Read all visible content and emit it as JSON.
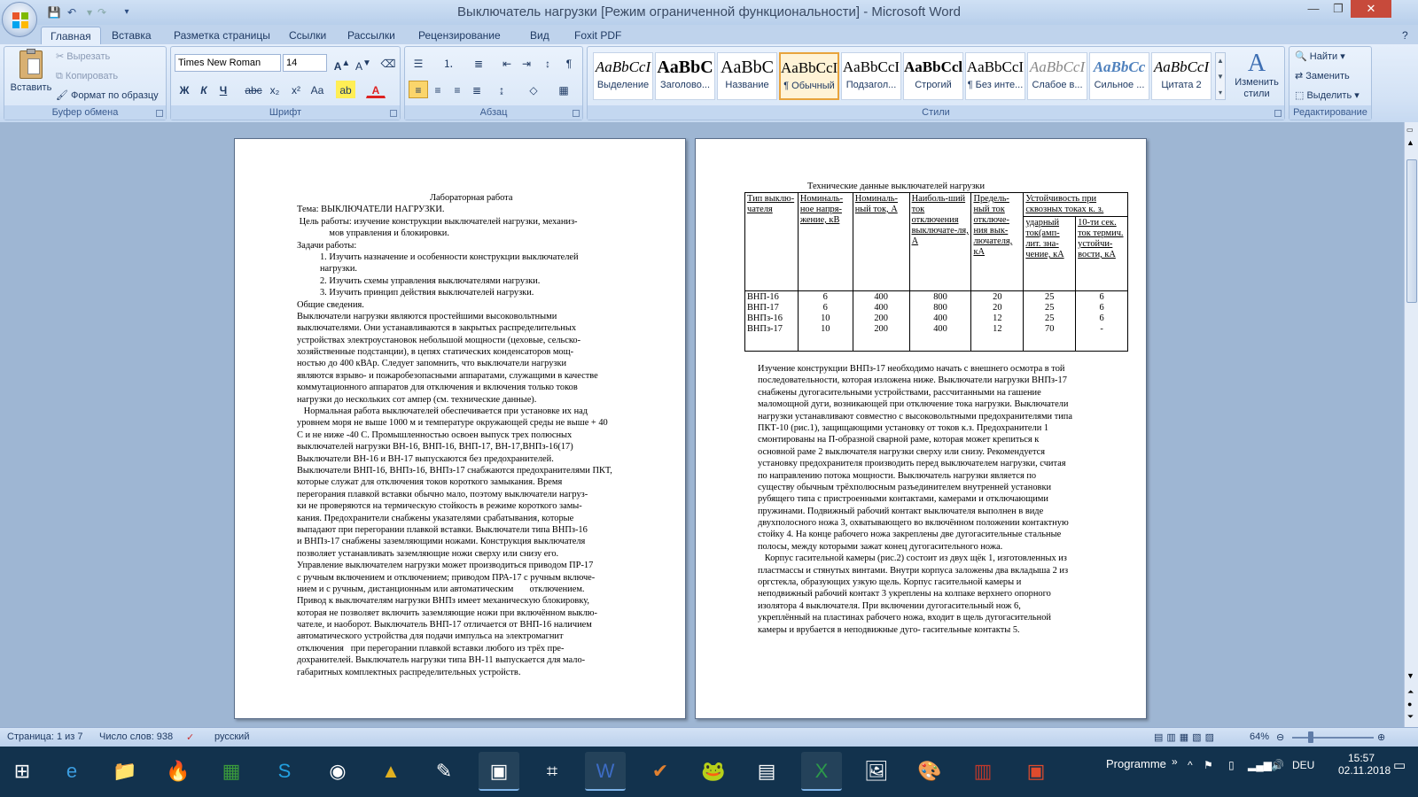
{
  "window": {
    "title": "Выключатель нагрузки [Режим ограниченной функциональности] - Microsoft Word"
  },
  "tabs": [
    "Главная",
    "Вставка",
    "Разметка страницы",
    "Ссылки",
    "Рассылки",
    "Рецензирование",
    "Вид",
    "Foxit PDF"
  ],
  "active_tab": "Главная",
  "clipboard": {
    "paste": "Вставить",
    "cut": "Вырезать",
    "copy": "Копировать",
    "format_painter": "Формат по образцу",
    "label": "Буфер обмена"
  },
  "font": {
    "name": "Times New Roman",
    "size": "14",
    "label": "Шрифт"
  },
  "paragraph": {
    "label": "Абзац"
  },
  "styles": {
    "label": "Стили",
    "items": [
      {
        "sample": "AaBbCcI",
        "name": "Выделение"
      },
      {
        "sample": "AaBbC",
        "name": "Заголово..."
      },
      {
        "sample": "AaBbC",
        "name": "Название"
      },
      {
        "sample": "AaBbCcI",
        "name": "¶ Обычный"
      },
      {
        "sample": "AaBbCcI",
        "name": "Подзагол..."
      },
      {
        "sample": "AaBbCcl",
        "name": "Строгий"
      },
      {
        "sample": "AaBbCcI",
        "name": "¶ Без инте..."
      },
      {
        "sample": "AaBbCcI",
        "name": "Слабое в..."
      },
      {
        "sample": "AaBbCc",
        "name": "Сильное ..."
      },
      {
        "sample": "AaBbCcI",
        "name": "Цитата 2"
      }
    ],
    "change": "Изменить стили"
  },
  "editing": {
    "label": "Редактирование",
    "find": "Найти",
    "replace": "Заменить",
    "select": "Выделить"
  },
  "page1": {
    "lines": [
      "Лабораторная работа",
      "Тема: ВЫКЛЮЧАТЕЛИ НАГРУЗКИ.",
      " Цель работы: изучение конструкции выключателей нагрузки, механиз-",
      "              мов управления и блокировки.",
      "Задачи работы:",
      "          1. Изучить назначение и особенности конструкции выключателей",
      "          нагрузки.",
      "          2. Изучить схемы управления выключателями нагрузки.",
      "          3. Изучить принцип действия выключателей нагрузки.",
      "Общие сведения.",
      "Выключатели нагрузки являются простейшими высоковольтными",
      "выключателями. Они устанавливаются в закрытых распределительных",
      "устройствах электроустановок небольшой мощности (цеховые, сельско-",
      "хозяйственные подстанции), в цепях статических конденсаторов мощ-",
      "ностью до 400 кВАр. Следует запомнить, что выключатели нагрузки",
      "являются взрыво- и пожаробезопасными аппаратами, служащими в качестве",
      "коммутационного аппаратов для отключения и включения только токов",
      "нагрузки до нескольких сот ампер (см. технические данные).",
      "   Нормальная работа выключателей обеспечивается при установке их над",
      "уровнем моря не выше 1000 м и температуре окружающей среды не выше + 40",
      "С и не ниже -40 С. Промышленностью освоен выпуск трех полюсных",
      "выключателей нагрузки ВН-16, ВНП-16, ВНП-17, ВН-17,ВНПз-16(17)",
      "Выключатели ВН-16 и ВН-17 выпускаются без предохранителей.",
      "Выключатели ВНП-16, ВНПз-16, ВНПз-17 снабжаются предохранителями ПКТ,",
      "которые служат для отключения токов короткого замыкания. Время",
      "перегорания плавкой вставки обычно мало, поэтому выключатели нагруз-",
      "ки не проверяются на термическую стойкость в режиме короткого замы-",
      "кания. Предохранители снабжены указателями срабатывания, которые",
      "выпадают при перегорании плавкой вставки. Выключатели типа ВНПз-16",
      "и ВНПз-17 снабжены заземляющими ножами. Конструкция выключателя",
      "позволяет устанавливать заземляющие ножи сверху или снизу его.",
      "Управление выключателем нагрузки может производиться приводом ПР-17",
      "с ручным включением и отключением; приводом ПРА-17 с ручным включе-",
      "нием и с ручным, дистанционным или автоматическим       отключением.",
      "Привод к выключателям нагрузки ВНПз имеет механическую блокировку,",
      "которая не позволяет включить заземляющие ножи при включённом выклю-",
      "чателе, и наоборот. Выключатель ВНП-17 отличается от ВНП-16 наличием",
      "автоматического устройства для подачи импульса на электромагнит",
      "отключения   при перегорании плавкой вставки любого из трёх пре-",
      "дохранителей. Выключатель нагрузки типа ВН-11 выпускается для мало-",
      "габаритных комплектных распределительных устройств."
    ]
  },
  "page2": {
    "table_title": "Технические данные выключателей нагрузки",
    "headers": {
      "type": "Тип выклю-чателя",
      "voltage": "Номиналь-ное напря-жение, кВ",
      "current": "Номиналь-ный ток, А",
      "max_break": "Наиболь-ший ток отключения выключате-ля, А",
      "limit_break": "Предель-ный ток отключе-ния вык-лючателя, кА",
      "through": "Устойчивость при сквозных токах к. з.",
      "peak": "ударный ток(амп-лит. зна-чение, кА",
      "thermal": "10-ти сек. ток термич. устойчи-вости, кА"
    },
    "rows": [
      [
        "ВНП-16",
        "6",
        "400",
        "800",
        "20",
        "25",
        "6"
      ],
      [
        "ВНП-17",
        "6",
        "400",
        "800",
        "20",
        "25",
        "6"
      ],
      [
        "ВНПз-16",
        "10",
        "200",
        "400",
        "12",
        "25",
        "6"
      ],
      [
        "ВНПз-17",
        "10",
        "200",
        "400",
        "12",
        "70",
        "-"
      ]
    ],
    "lines": [
      "Изучение конструкции ВНПз-17 необходимо начать с внешнего осмотра в той",
      "последовательности, которая изложена ниже. Выключатели нагрузки ВНПз-17",
      "снабжены дугогасительными устройствами, рассчитанными на гашение",
      "маломощной дуги, возникающей при отключение тока нагрузки. Выключатели",
      "нагрузки устанавливают совместно с высоковольтными предохранителями типа",
      "ПКТ-10 (рис.1), защищающими установку от токов к.з. Предохранители 1",
      "смонтированы на П-образной сварной раме, которая может крепиться к",
      "основной раме 2 выключателя нагрузки сверху или снизу. Рекомендуется",
      "установку предохранителя производить перед выключателем нагрузки, считая",
      "по направлению потока мощности. Выключатель нагрузки является по",
      "существу обычным трёхполюсным разъединителем внутренней установки",
      "рубящего типа с пристроенными контактами, камерами и отключающими",
      "пружинами. Подвижный рабочий контакт выключателя выполнен в виде",
      "двухполосного ножа 3, охватывающего во включённом положении контактную",
      "стойку 4. На конце рабочего ножа закреплены две дугогасительные стальные",
      "полосы, между которыми зажат конец дугогасительного ножа.",
      "   Корпус гасительной камеры (рис.2) состоит из двух щёк 1, изготовленных из",
      "пластмассы и стянутых винтами. Внутри корпуса заложены два вкладыша 2 из",
      "оргстекла, образующих узкую щель. Корпус гасительной камеры и",
      "неподвижный рабочий контакт 3 укреплены на колпаке верхнего опорного",
      "изолятора 4 выключателя. При включении дугогасительный нож 6,",
      "укреплённый на пластинах рабочего ножа, входит в щель дугогасительной",
      "камеры и врубается в неподвижные дуго- гасительные контакты 5."
    ]
  },
  "status": {
    "page": "Страница: 1 из 7",
    "words": "Число слов: 938",
    "lang": "русский",
    "zoom": "64%"
  },
  "taskbar": {
    "programme": "Programme",
    "lang": "DEU",
    "time": "15:57",
    "date": "02.11.2018"
  }
}
